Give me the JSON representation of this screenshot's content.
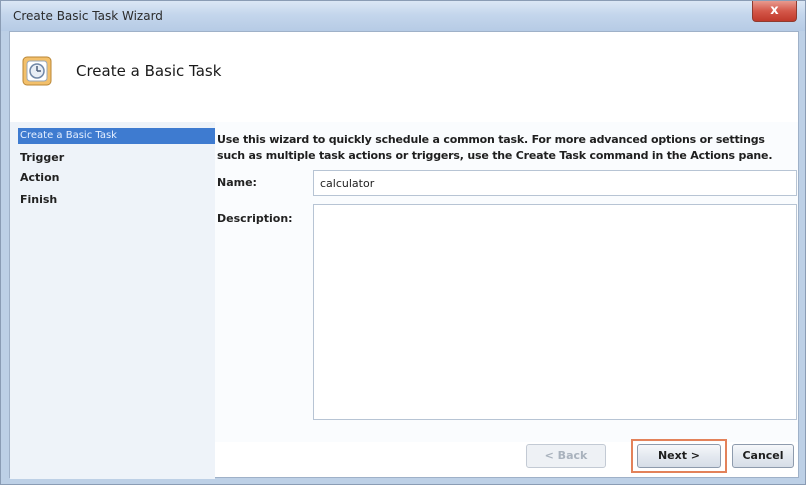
{
  "window": {
    "title": "Create Basic Task Wizard",
    "close_glyph": "x"
  },
  "header": {
    "title": "Create a Basic Task",
    "icon": "task-scheduler-icon"
  },
  "steps": [
    {
      "label": "Create a Basic Task",
      "active": true
    },
    {
      "label": "Trigger",
      "active": false
    },
    {
      "label": "Action",
      "active": false
    },
    {
      "label": "Finish",
      "active": false
    }
  ],
  "main": {
    "intro_line1": "Use this wizard to quickly schedule a common task.  For more advanced options or settings",
    "intro_line2": "such as multiple task actions or triggers, use the Create Task command in the Actions pane.",
    "name_label": "Name:",
    "name_value": "calculator",
    "description_label": "Description:",
    "description_value": ""
  },
  "buttons": {
    "back": "< Back",
    "next": "Next >",
    "cancel": "Cancel"
  },
  "colors": {
    "active_step": "#3e7bd0",
    "next_highlight": "#e3825a"
  }
}
